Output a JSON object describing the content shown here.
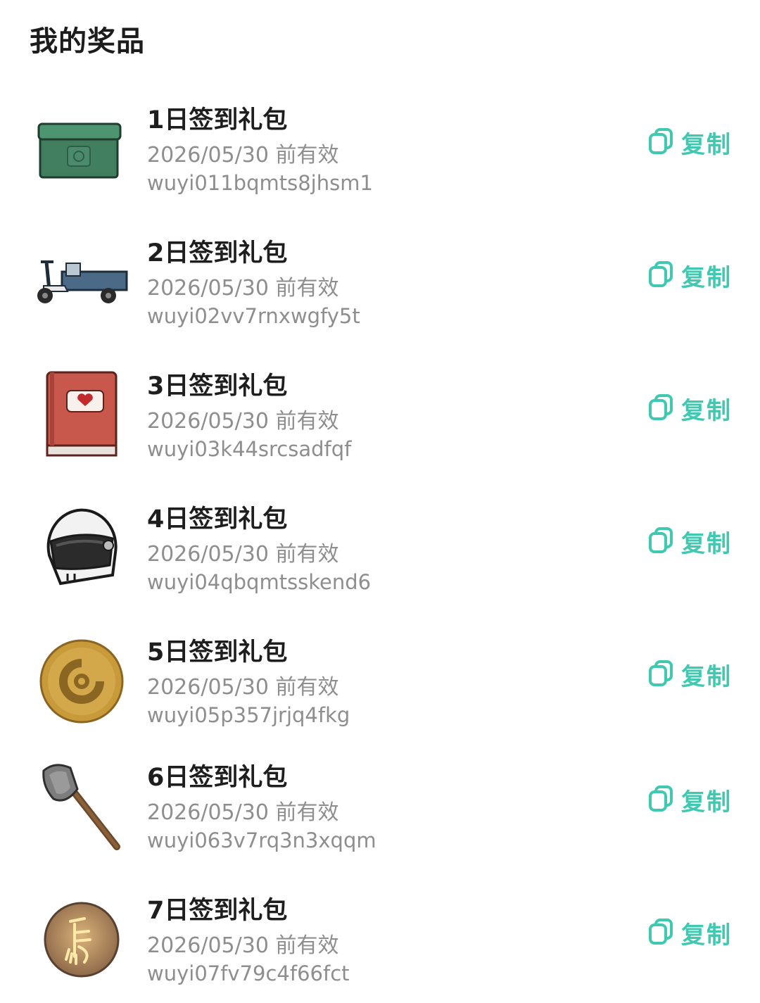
{
  "page_title": "我的奖品",
  "accent_color": "#3ec9b0",
  "prizes": [
    {
      "name": "1日签到礼包",
      "expiry": "2026/05/30 前有效",
      "code": "wuyi011bqmts8jhsm1",
      "icon": "green-chest-icon",
      "copy_label": "复制"
    },
    {
      "name": "2日签到礼包",
      "expiry": "2026/05/30 前有效",
      "code": "wuyi02vv7rnxwgfy5t",
      "icon": "electric-tricycle-icon",
      "copy_label": "复制"
    },
    {
      "name": "3日签到礼包",
      "expiry": "2026/05/30 前有效",
      "code": "wuyi03k44srcsadfqf",
      "icon": "red-book-heart-icon",
      "copy_label": "复制"
    },
    {
      "name": "4日签到礼包",
      "expiry": "2026/05/30 前有效",
      "code": "wuyi04qbqmtsskend6",
      "icon": "helmet-icon",
      "copy_label": "复制"
    },
    {
      "name": "5日签到礼包",
      "expiry": "2026/05/30 前有效",
      "code": "wuyi05p357jrjq4fkg",
      "icon": "gold-coin-icon",
      "copy_label": "复制"
    },
    {
      "name": "6日签到礼包",
      "expiry": "2026/05/30 前有效",
      "code": "wuyi063v7rq3n3xqqm",
      "icon": "axe-icon",
      "copy_label": "复制"
    },
    {
      "name": "7日签到礼包",
      "expiry": "2026/05/30 前有效",
      "code": "wuyi07fv79c4f66fct",
      "icon": "horse-emblem-icon",
      "copy_label": "复制"
    }
  ]
}
